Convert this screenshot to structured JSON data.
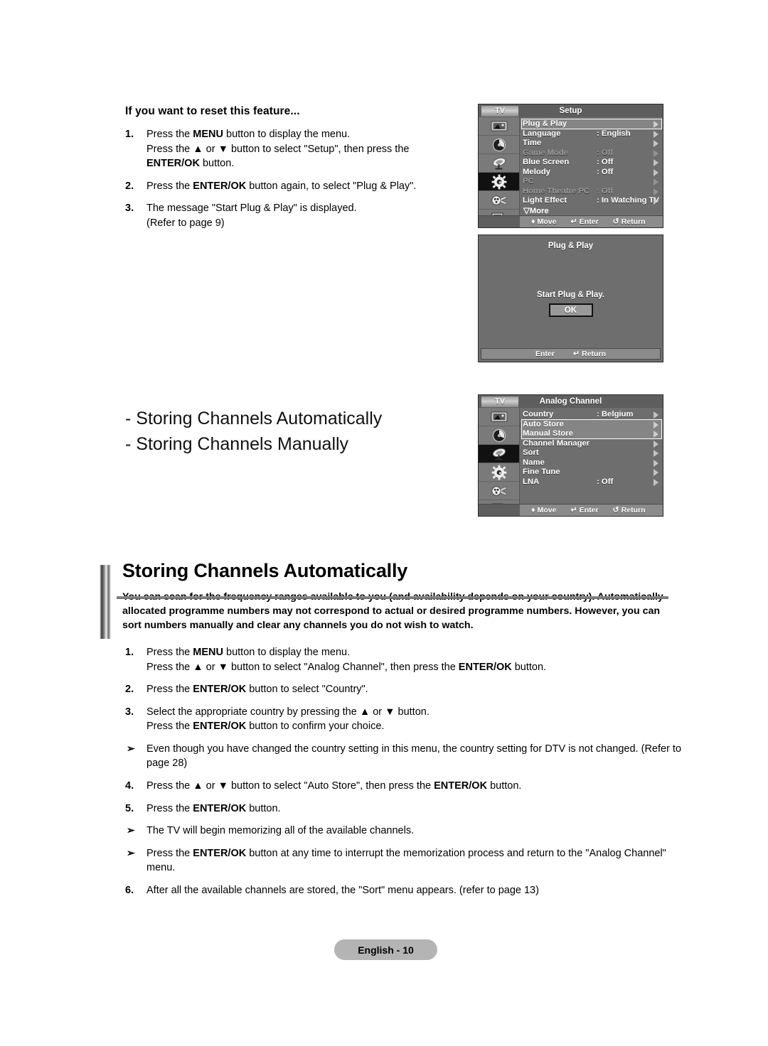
{
  "reset_section": {
    "title": "If you want to reset this feature...",
    "steps": [
      {
        "num": "1.",
        "lines": [
          "Press the MENU button to display the menu.",
          "Press the ▲ or ▼ button to select \"Setup\", then press the",
          "ENTER/OK button."
        ]
      },
      {
        "num": "2.",
        "lines": [
          "Press the ENTER/OK button again, to select \"Plug & Play\"."
        ]
      },
      {
        "num": "3.",
        "lines": [
          "The message \"Start Plug & Play\" is displayed.",
          "(Refer to page 9)"
        ]
      }
    ]
  },
  "setup_menu": {
    "tab_label": "TV",
    "title": "Setup",
    "sidebar_icons": [
      "picture-icon",
      "sound-icon",
      "channel-dish-icon",
      "setup-gear-icon",
      "input-plug-icon",
      "pc-setup-icon"
    ],
    "active_icon_index": 3,
    "rows": [
      {
        "label": "Plug & Play",
        "value": "",
        "dim": false
      },
      {
        "label": "Language",
        "value": ": English",
        "dim": false
      },
      {
        "label": "Time",
        "value": "",
        "dim": false
      },
      {
        "label": "Game Mode",
        "value": ": Off",
        "dim": true
      },
      {
        "label": "Blue Screen",
        "value": ": Off",
        "dim": false
      },
      {
        "label": "Melody",
        "value": ": Off",
        "dim": false
      },
      {
        "label": "PC",
        "value": "",
        "dim": true
      },
      {
        "label": "Home Theatre PC",
        "value": ": Off",
        "dim": true
      },
      {
        "label": "Light Effect",
        "value": ": In Watching TV",
        "dim": false
      }
    ],
    "more_label": "▽More",
    "highlight_start": 0,
    "highlight_count": 1,
    "footer": [
      {
        "glyph": "♦",
        "label": "Move"
      },
      {
        "glyph": "↵",
        "label": "Enter"
      },
      {
        "glyph": "↺",
        "label": "Return"
      }
    ]
  },
  "plug_play_dialog": {
    "title": "Plug & Play",
    "message": "Start Plug & Play.",
    "ok_label": "OK",
    "footer": [
      {
        "glyph": "",
        "label": "Enter"
      },
      {
        "glyph": "↵",
        "label": "Return"
      }
    ]
  },
  "analog_menu": {
    "tab_label": "TV",
    "title": "Analog Channel",
    "sidebar_icons": [
      "picture-icon",
      "sound-icon",
      "channel-dish-icon",
      "setup-gear-icon",
      "input-plug-icon",
      "pc-setup-icon"
    ],
    "active_icon_index": 2,
    "rows": [
      {
        "label": "Country",
        "value": ": Belgium",
        "dim": false
      },
      {
        "label": "Auto Store",
        "value": "",
        "dim": false
      },
      {
        "label": "Manual Store",
        "value": "",
        "dim": false
      },
      {
        "label": "Channel Manager",
        "value": "",
        "dim": false
      },
      {
        "label": "Sort",
        "value": "",
        "dim": false
      },
      {
        "label": "Name",
        "value": "",
        "dim": false
      },
      {
        "label": "Fine Tune",
        "value": "",
        "dim": false
      },
      {
        "label": "LNA",
        "value": ": Off",
        "dim": false
      }
    ],
    "highlight_start": 1,
    "highlight_count": 2,
    "footer": [
      {
        "glyph": "♦",
        "label": "Move"
      },
      {
        "glyph": "↵",
        "label": "Enter"
      },
      {
        "glyph": "↺",
        "label": "Return"
      }
    ]
  },
  "chapter_list": {
    "line1": "- Storing Channels Automatically",
    "line2": "- Storing Channels Manually"
  },
  "main_section": {
    "heading": "Storing Channels Automatically",
    "intro": "You can scan for the frequency ranges available to you (and availability depends on your country). Automatically allocated programme numbers may not correspond to actual or desired programme numbers. However, you can sort numbers manually and clear any channels you do not wish to watch.",
    "steps": [
      {
        "type": "num",
        "num": "1.",
        "lines": [
          "Press the MENU button to display the menu.",
          "Press the ▲ or ▼ button to select \"Analog Channel\", then press the ENTER/OK button."
        ]
      },
      {
        "type": "num",
        "num": "2.",
        "lines": [
          "Press the ENTER/OK button to select \"Country\"."
        ]
      },
      {
        "type": "num",
        "num": "3.",
        "lines": [
          "Select the appropriate country by pressing the ▲ or ▼ button.",
          "Press the ENTER/OK button to confirm your choice."
        ]
      },
      {
        "type": "bullet",
        "num": "➢",
        "lines": [
          "Even though you have changed the country setting in this menu, the country setting for DTV is not changed. (Refer to page 28)"
        ]
      },
      {
        "type": "num",
        "num": "4.",
        "lines": [
          "Press the ▲ or ▼ button to select \"Auto Store\", then press the ENTER/OK button."
        ]
      },
      {
        "type": "num",
        "num": "5.",
        "lines": [
          "Press the ENTER/OK button."
        ]
      },
      {
        "type": "bullet",
        "num": "➢",
        "lines": [
          "The TV will begin memorizing all of the available channels."
        ]
      },
      {
        "type": "bullet",
        "num": "➢",
        "lines": [
          "Press the ENTER/OK button at any time to interrupt the memorization process and return to the \"Analog Channel\" menu."
        ]
      },
      {
        "type": "num",
        "num": "6.",
        "lines": [
          "After all the available channels are stored, the \"Sort\" menu appears. (refer to page 13)"
        ]
      }
    ]
  },
  "footer_badge": "English - 10",
  "colors": {
    "osd_bg": "#6e6e6e",
    "osd_sidebar": "#7a7a7a",
    "osd_footer": "#8b8b8b",
    "badge_bg": "#b4b4b4",
    "rule": "#7f7f7f"
  }
}
